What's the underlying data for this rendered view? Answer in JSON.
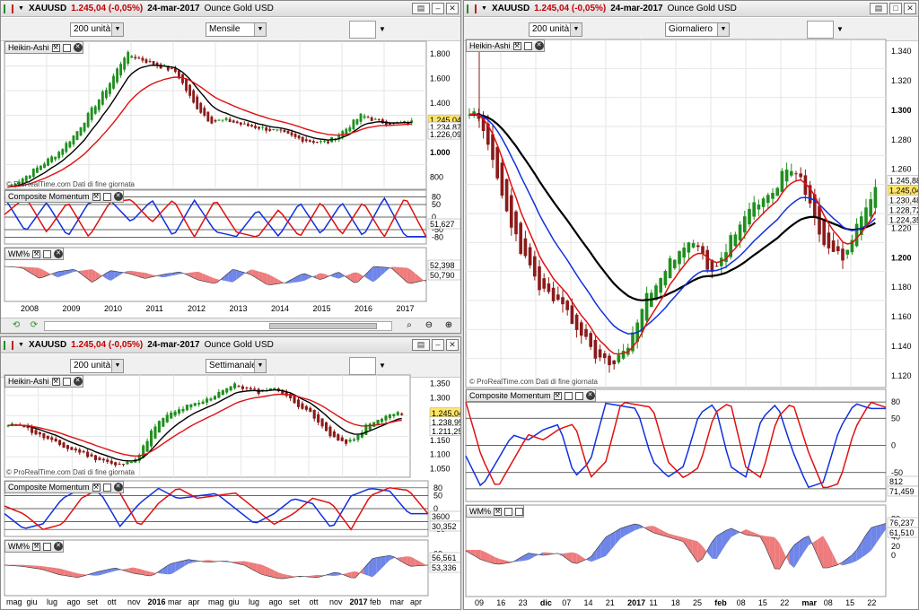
{
  "instrument": {
    "symbol": "XAUUSD",
    "change": "1.245,04 (-0,05%)",
    "date": "24-mar-2017",
    "name": "Ounce Gold USD"
  },
  "watermark": "© ProRealTime.com  Dati di fine giornata",
  "panel_labels": {
    "heikin": "Heikin-Ashi",
    "cm": "Composite Momentum",
    "wm": "WM%"
  },
  "colors": {
    "up": "#1f8f1f",
    "down": "#8b1a1a",
    "black_ma": "#000000",
    "red_ma": "#e01010",
    "blue_ma": "#1030e0",
    "wm_up": "#6f86e8",
    "wm_down": "#ee7c7c",
    "price_tag": "#ffe566"
  },
  "icons": [
    "chart-type-icon",
    "dropdown-caret-icon",
    "indicator-tool-icon",
    "window-list-icon",
    "minimize-icon",
    "maximize-icon",
    "close-icon",
    "wrench-icon",
    "properties-icon",
    "hscroll-left-icon",
    "hscroll-right-icon",
    "zoom-fit-icon",
    "zoom-out-icon",
    "zoom-in-icon"
  ],
  "windows": [
    {
      "id": "monthly",
      "units": "200 unità",
      "period": "Mensile",
      "main_ticks": [
        "1.800",
        "1.600",
        "1.400",
        "1.200",
        "1.000",
        "800"
      ],
      "price_tags": [
        {
          "v": "1.245,04",
          "c": "#ffe566"
        },
        {
          "v": "1.234,87",
          "c": "#ffffff"
        },
        {
          "v": "1.226,09",
          "c": "#ffffff"
        }
      ],
      "cm_ticks": [
        "80",
        "50",
        "0",
        "-50",
        "-80"
      ],
      "cm_tags": [
        "51,627"
      ],
      "wm_tags": [
        "52,398",
        "50,790"
      ],
      "xlabels": [
        "2008",
        "2009",
        "2010",
        "2011",
        "2012",
        "2013",
        "2014",
        "2015",
        "2016",
        "2017"
      ],
      "chart_data": {
        "type": "candlestick",
        "ylim": [
          700,
          1900
        ],
        "price_series_first_last": [
          820,
          1245
        ],
        "last": 1245.04
      }
    },
    {
      "id": "weekly",
      "units": "200 unità",
      "period": "Settimanale",
      "main_ticks": [
        "1.350",
        "1.300",
        "1.250",
        "1.200",
        "1.150",
        "1.100",
        "1.050"
      ],
      "price_tags": [
        {
          "v": "1.245,04",
          "c": "#ffe566"
        },
        {
          "v": "1.238,95",
          "c": "#ffffff"
        },
        {
          "v": "1.211,25",
          "c": "#ffffff"
        }
      ],
      "cm_ticks": [
        "80",
        "50",
        "0",
        "-50",
        "-80"
      ],
      "cm_tags": [
        "3600",
        "30,352"
      ],
      "wm_tags": [
        "56,561",
        "53,336"
      ],
      "wm_ticks": [
        "60",
        "40",
        "20"
      ],
      "xlabels": [
        "mag",
        "giu",
        "lug",
        "ago",
        "set",
        "ott",
        "nov",
        "2016",
        "mar",
        "apr",
        "mag",
        "giu",
        "lug",
        "ago",
        "set",
        "ott",
        "nov",
        "2017",
        "feb",
        "mar",
        "apr"
      ],
      "chart_data": {
        "type": "candlestick",
        "ylim": [
          1020,
          1380
        ],
        "last": 1245.04
      }
    },
    {
      "id": "daily",
      "units": "200 unità",
      "period": "Giornaliero",
      "main_ticks": [
        "1.340",
        "1.320",
        "1.300",
        "1.280",
        "1.260",
        "1.240",
        "1.220",
        "1.200",
        "1.180",
        "1.160",
        "1.140",
        "1.120"
      ],
      "price_tags": [
        {
          "v": "1.245,88",
          "c": "#ffffff"
        },
        {
          "v": "1.245,04",
          "c": "#ffe566"
        },
        {
          "v": "1.230,48",
          "c": "#ffffff"
        },
        {
          "v": "1.228,72",
          "c": "#ffffff"
        },
        {
          "v": "1.224,35",
          "c": "#ffffff"
        }
      ],
      "cm_ticks": [
        "80",
        "50",
        "0",
        "-50",
        "-80"
      ],
      "cm_tags": [
        "812",
        "71,459"
      ],
      "wm_tags": [
        "76,237",
        "61,510"
      ],
      "wm_ticks": [
        "80",
        "60",
        "40",
        "20",
        "0"
      ],
      "xlabels": [
        "09",
        "16",
        "23",
        "dic",
        "07",
        "14",
        "21",
        "2017",
        "11",
        "18",
        "25",
        "feb",
        "08",
        "15",
        "22",
        "mar",
        "08",
        "15",
        "22"
      ],
      "chart_data": {
        "type": "candlestick",
        "ylim": [
          1112,
          1348
        ],
        "last": 1245.04
      }
    }
  ]
}
